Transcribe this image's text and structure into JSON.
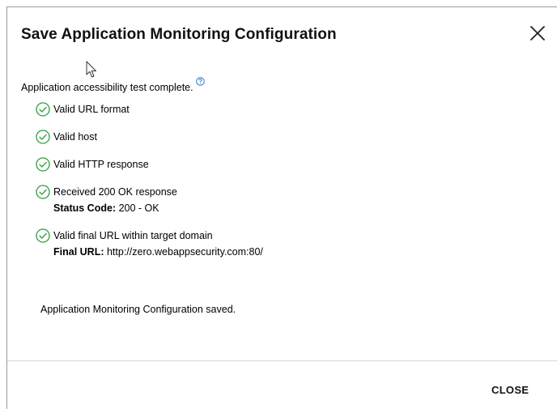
{
  "dialog": {
    "title": "Save Application Monitoring Configuration",
    "summary": "Application accessibility test complete.",
    "checks": [
      {
        "label": "Valid URL format"
      },
      {
        "label": "Valid host"
      },
      {
        "label": "Valid HTTP response"
      },
      {
        "label": "Received 200 OK response",
        "detail_label": "Status Code:",
        "detail_value": " 200 - OK"
      },
      {
        "label": "Valid final URL within target domain",
        "detail_label": "Final URL:",
        "detail_value": " http://zero.webappsecurity.com:80/"
      }
    ],
    "saved_message": "Application Monitoring Configuration saved.",
    "close_label": "CLOSE"
  },
  "colors": {
    "check_green": "#2e9e3e",
    "help_blue": "#2b7bd6",
    "divider": "#d9d9d9"
  },
  "icons": {
    "close": "close-icon",
    "help": "help-icon",
    "check": "check-circle-icon",
    "cursor": "mouse-pointer-icon"
  }
}
